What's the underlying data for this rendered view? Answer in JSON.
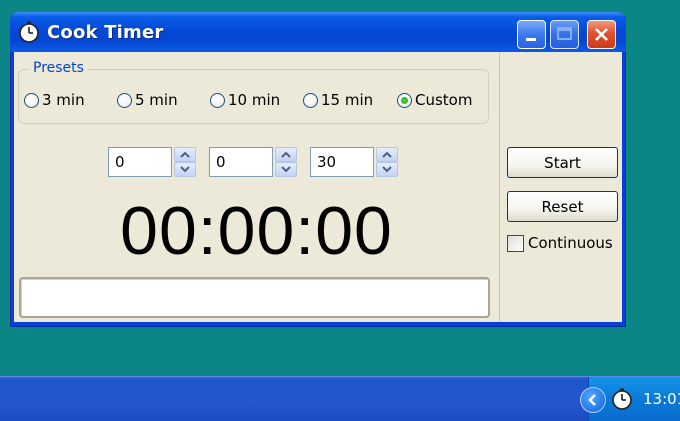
{
  "window": {
    "title": "Cook Timer"
  },
  "presets": {
    "group_label": "Presets",
    "options": [
      {
        "label": "3 min",
        "checked": false
      },
      {
        "label": "5 min",
        "checked": false
      },
      {
        "label": "10 min",
        "checked": false
      },
      {
        "label": "15 min",
        "checked": false
      },
      {
        "label": "Custom",
        "checked": true
      }
    ]
  },
  "spinners": [
    {
      "value": "0"
    },
    {
      "value": "0"
    },
    {
      "value": "30"
    }
  ],
  "readout": "00:00:00",
  "buttons": {
    "start_label": "Start",
    "reset_label": "Reset"
  },
  "continuous": {
    "label": "Continuous",
    "checked": false
  },
  "taskbar": {
    "clock_text": "13:01"
  },
  "colors": {
    "desktop": "#0b8585",
    "titlebar": "#0549d8",
    "group_label": "#0046d5"
  }
}
